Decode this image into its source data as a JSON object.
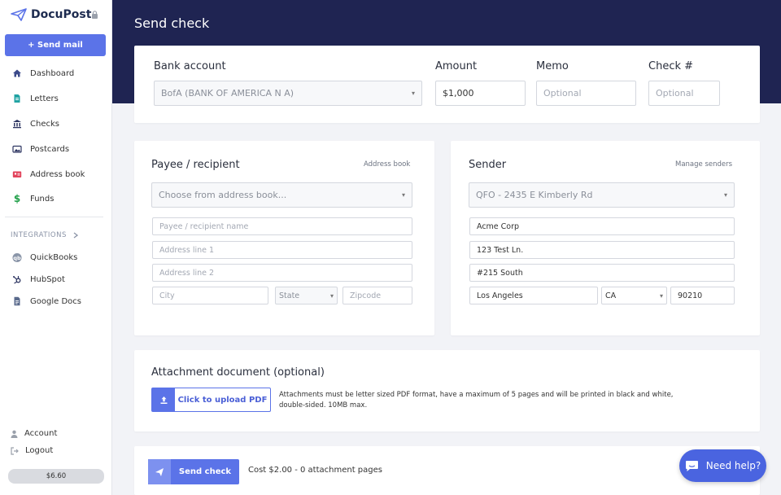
{
  "sidebar": {
    "logo_text": "DocuPost",
    "send_mail_label": "+ Send mail",
    "nav": [
      {
        "label": "Dashboard",
        "icon": "home-icon"
      },
      {
        "label": "Letters",
        "icon": "document-icon"
      },
      {
        "label": "Checks",
        "icon": "bank-icon"
      },
      {
        "label": "Postcards",
        "icon": "postcard-icon"
      },
      {
        "label": "Address book",
        "icon": "address-card-icon"
      },
      {
        "label": "Funds",
        "icon": "dollar-icon"
      }
    ],
    "integrations_label": "INTEGRATIONS",
    "integrations": [
      {
        "label": "QuickBooks",
        "icon": "quickbooks-icon"
      },
      {
        "label": "HubSpot",
        "icon": "hubspot-icon"
      },
      {
        "label": "Google Docs",
        "icon": "google-docs-icon"
      }
    ],
    "account_label": "Account",
    "logout_label": "Logout",
    "balance": "$6.60"
  },
  "header": {
    "title": "Send check"
  },
  "check_details": {
    "bank_account_label": "Bank account",
    "bank_account_value": "BofA (BANK OF AMERICA N A)",
    "amount_label": "Amount",
    "amount_value": "$1,000",
    "memo_label": "Memo",
    "memo_placeholder": "Optional",
    "check_no_label": "Check #",
    "check_no_placeholder": "Optional"
  },
  "payee": {
    "title": "Payee / recipient",
    "address_book_link": "Address book",
    "select_placeholder": "Choose from address book...",
    "name_placeholder": "Payee / recipient name",
    "address1_placeholder": "Address line 1",
    "address2_placeholder": "Address line 2",
    "city_placeholder": "City",
    "state_placeholder": "State",
    "zip_placeholder": "Zipcode"
  },
  "sender": {
    "title": "Sender",
    "manage_link": "Manage senders",
    "select_value": "QFO - 2435 E Kimberly Rd",
    "name": "Acme Corp",
    "address1": "123 Test Ln.",
    "address2": "#215 South",
    "city": "Los Angeles",
    "state": "CA",
    "zip": "90210"
  },
  "attachment": {
    "title": "Attachment document (optional)",
    "upload_label": "Click to upload PDF",
    "note": "Attachments must be letter sized PDF format, have a maximum of 5 pages and will be printed in black and white, double-sided. 10MB max."
  },
  "footer": {
    "send_label": "Send check",
    "cost_text": "Cost $2.00 - 0 attachment pages"
  },
  "help": {
    "label": "Need help?"
  },
  "colors": {
    "accent": "#5b73e8",
    "header": "#1f2452"
  }
}
